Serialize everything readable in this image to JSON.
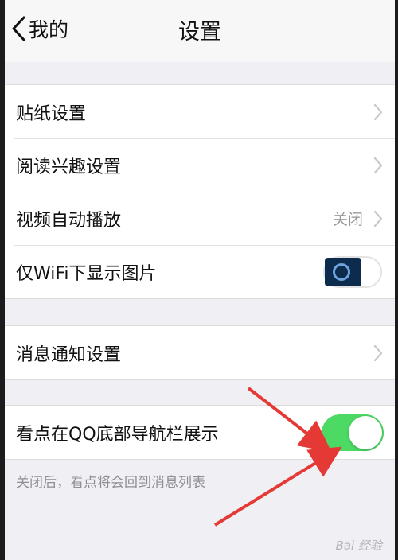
{
  "navbar": {
    "back_label": "我的",
    "title": "设置"
  },
  "group1": {
    "items": [
      {
        "label": "贴纸设置"
      },
      {
        "label": "阅读兴趣设置"
      },
      {
        "label": "视频自动播放",
        "value": "关闭"
      },
      {
        "label": "仅WiFi下显示图片",
        "toggle": false
      }
    ]
  },
  "group2": {
    "items": [
      {
        "label": "消息通知设置"
      }
    ]
  },
  "group3": {
    "items": [
      {
        "label": "看点在QQ底部导航栏展示",
        "toggle": true
      }
    ],
    "hint": "关闭后，看点将会回到消息列表"
  },
  "watermark": "Bai 经验",
  "colors": {
    "toggle_on": "#4cd964",
    "annotation_arrow": "#e53935",
    "background": "#efeff4"
  }
}
